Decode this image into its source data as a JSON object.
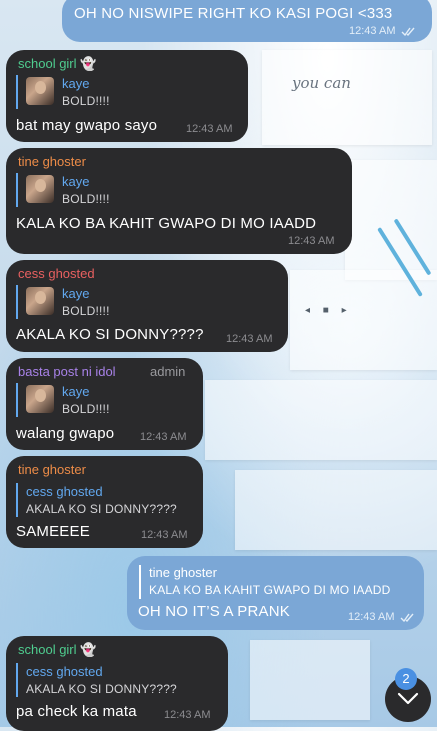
{
  "colors": {
    "incoming_bubble": "#2a2a2c",
    "outgoing_bubble": "#7ba7d6",
    "reply_accent": "#62a8ef",
    "timestamp": "#8c8c90"
  },
  "wallpaper_text": "you can",
  "messages": [
    {
      "direction": "outgoing",
      "text": "OH NO NISWIPE RIGHT KO KASI POGI <333",
      "time": "12:43 AM",
      "read": true
    },
    {
      "direction": "incoming",
      "sender": "school girl 👻",
      "sender_color": "#4fcd8f",
      "reply": {
        "name": "kaye",
        "text": "BOLD!!!!",
        "has_thumb": true
      },
      "text": "bat may gwapo sayo",
      "time": "12:43 AM"
    },
    {
      "direction": "incoming",
      "sender": "tine ghoster",
      "sender_color": "#ed8c48",
      "reply": {
        "name": "kaye",
        "text": "BOLD!!!!",
        "has_thumb": true
      },
      "text": "KALA KO BA KAHIT GWAPO DI MO IAADD",
      "time": "12:43 AM"
    },
    {
      "direction": "incoming",
      "sender": "cess ghosted",
      "sender_color": "#e86060",
      "reply": {
        "name": "kaye",
        "text": "BOLD!!!!",
        "has_thumb": true
      },
      "text": "AKALA KO SI DONNY????",
      "time": "12:43 AM"
    },
    {
      "direction": "incoming",
      "sender": "basta post ni idol",
      "sender_color": "#a882e8",
      "role": "admin",
      "reply": {
        "name": "kaye",
        "text": "BOLD!!!!",
        "has_thumb": true
      },
      "text": "walang gwapo",
      "time": "12:43 AM"
    },
    {
      "direction": "incoming",
      "sender": "tine ghoster",
      "sender_color": "#ed8c48",
      "reply": {
        "name": "cess ghosted",
        "text": "AKALA KO SI DONNY????",
        "has_thumb": false
      },
      "text": "SAMEEEE",
      "time": "12:43 AM"
    },
    {
      "direction": "outgoing",
      "reply": {
        "name": "tine ghoster",
        "text": "KALA KO BA KAHIT GWAPO DI MO IAADD",
        "has_thumb": false
      },
      "text": "OH NO IT’S A PRANK",
      "time": "12:43 AM",
      "read": true
    },
    {
      "direction": "incoming",
      "sender": "school girl 👻",
      "sender_color": "#4fcd8f",
      "reply": {
        "name": "cess ghosted",
        "text": "AKALA KO SI DONNY????",
        "has_thumb": false
      },
      "text": "pa check ka mata",
      "time": "12:43 AM"
    }
  ],
  "scroll_down": {
    "unread_count": "2",
    "icon": "chevron-down-icon"
  }
}
